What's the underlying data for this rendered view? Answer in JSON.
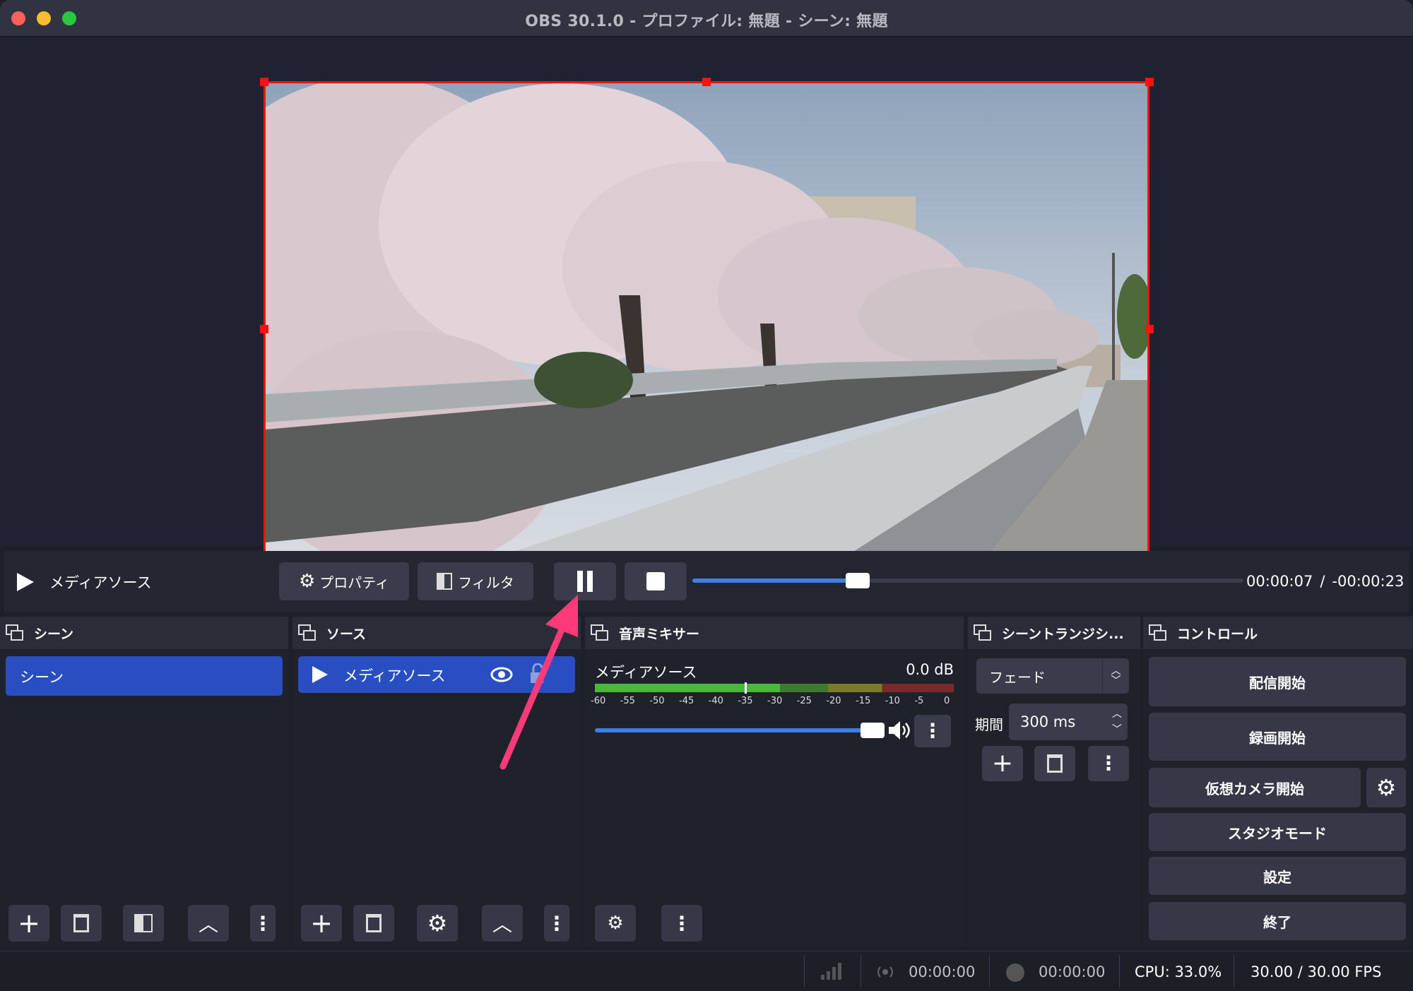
{
  "window": {
    "title": "OBS 30.1.0 - プロファイル: 無題 - シーン: 無題"
  },
  "media_bar": {
    "source_name": "メディアソース",
    "properties_label": "プロパティ",
    "filters_label": "フィルタ",
    "elapsed": "00:00:07",
    "separator": "/",
    "remaining": "-00:00:23",
    "progress": 0.3
  },
  "scenes_panel": {
    "title": "シーン",
    "items": [
      "シーン"
    ]
  },
  "sources_panel": {
    "title": "ソース",
    "items": [
      "メディアソース"
    ]
  },
  "mixer_panel": {
    "title": "音声ミキサー",
    "channel_name": "メディアソース",
    "level": "0.0 dB",
    "scale": [
      "-60",
      "-55",
      "-50",
      "-45",
      "-40",
      "-35",
      "-30",
      "-25",
      "-20",
      "-15",
      "-10",
      "-5",
      "0"
    ],
    "volume": 1.0
  },
  "transitions_panel": {
    "title": "シーントランジシ...",
    "transition": "フェード",
    "duration_label": "期間",
    "duration_value": "300 ms"
  },
  "controls_panel": {
    "title": "コントロール",
    "start_streaming": "配信開始",
    "start_recording": "録画開始",
    "start_virtualcam": "仮想カメラ開始",
    "studio_mode": "スタジオモード",
    "settings": "設定",
    "exit": "終了"
  },
  "status_bar": {
    "stream_time": "00:00:00",
    "record_time": "00:00:00",
    "cpu": "CPU: 33.0%",
    "fps": "30.00 / 30.00 FPS"
  },
  "colors": {
    "accent": "#284ec1",
    "selection_border": "#ff1111",
    "annotation_arrow": "#ff3a7a"
  }
}
